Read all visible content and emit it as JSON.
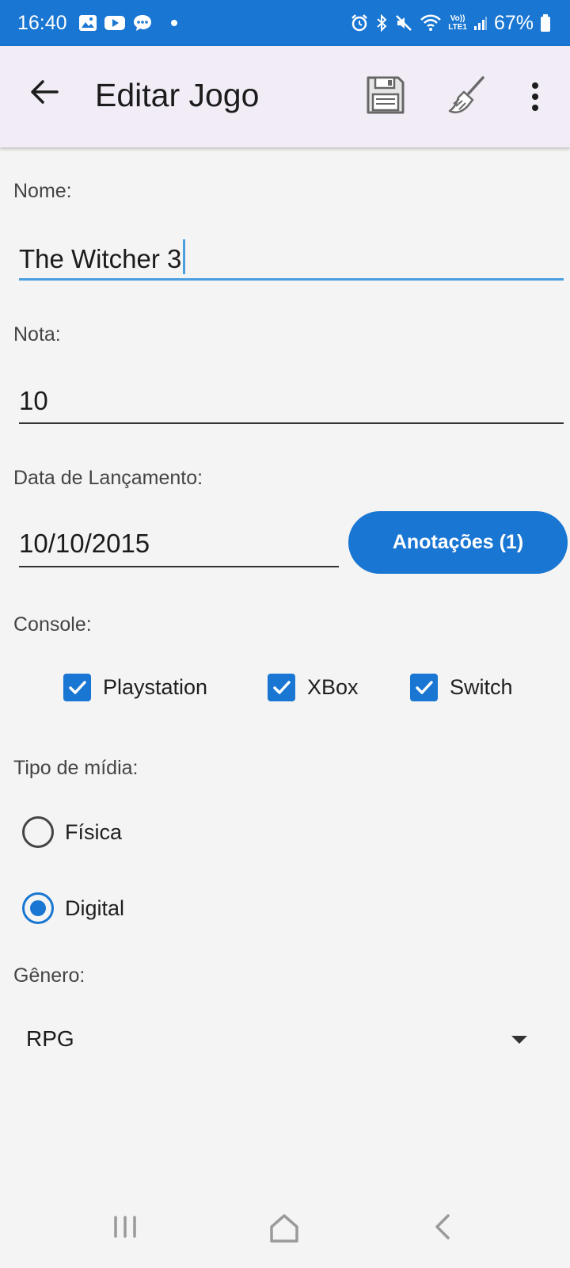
{
  "status_bar": {
    "time": "16:40",
    "battery": "67%",
    "left_icons": [
      "gallery-icon",
      "youtube-icon",
      "chat-icon",
      "dot-icon"
    ],
    "right_icons": [
      "alarm-icon",
      "bluetooth-icon",
      "mute-icon",
      "wifi-icon",
      "lte-icon",
      "signal-icon",
      "battery-icon"
    ],
    "lte_label_top": "Vo))",
    "lte_label_bottom": "LTE1"
  },
  "app_bar": {
    "title": "Editar Jogo",
    "actions": [
      "back-icon",
      "save-icon",
      "broom-icon",
      "more-vertical-icon"
    ]
  },
  "form": {
    "name": {
      "label": "Nome:",
      "value": "The Witcher 3"
    },
    "rating": {
      "label": "Nota:",
      "value": "10"
    },
    "release_date": {
      "label": "Data de Lançamento:",
      "value": "10/10/2015"
    },
    "notes_button": "Anotações (1)",
    "console": {
      "label": "Console:",
      "options": [
        {
          "label": "Playstation",
          "checked": true
        },
        {
          "label": "XBox",
          "checked": true
        },
        {
          "label": "Switch",
          "checked": true
        }
      ]
    },
    "media_type": {
      "label": "Tipo de mídia:",
      "options": [
        {
          "label": "Física",
          "selected": false
        },
        {
          "label": "Digital",
          "selected": true
        }
      ]
    },
    "genre": {
      "label": "Gênero:",
      "selected": "RPG"
    }
  },
  "colors": {
    "accent": "#1976d2",
    "app_bar_bg": "#f1ecf5",
    "page_bg": "#f4f4f4",
    "focus_underline": "#4a9fe0"
  },
  "nav_bar": [
    "recents-icon",
    "home-icon",
    "back-nav-icon"
  ]
}
